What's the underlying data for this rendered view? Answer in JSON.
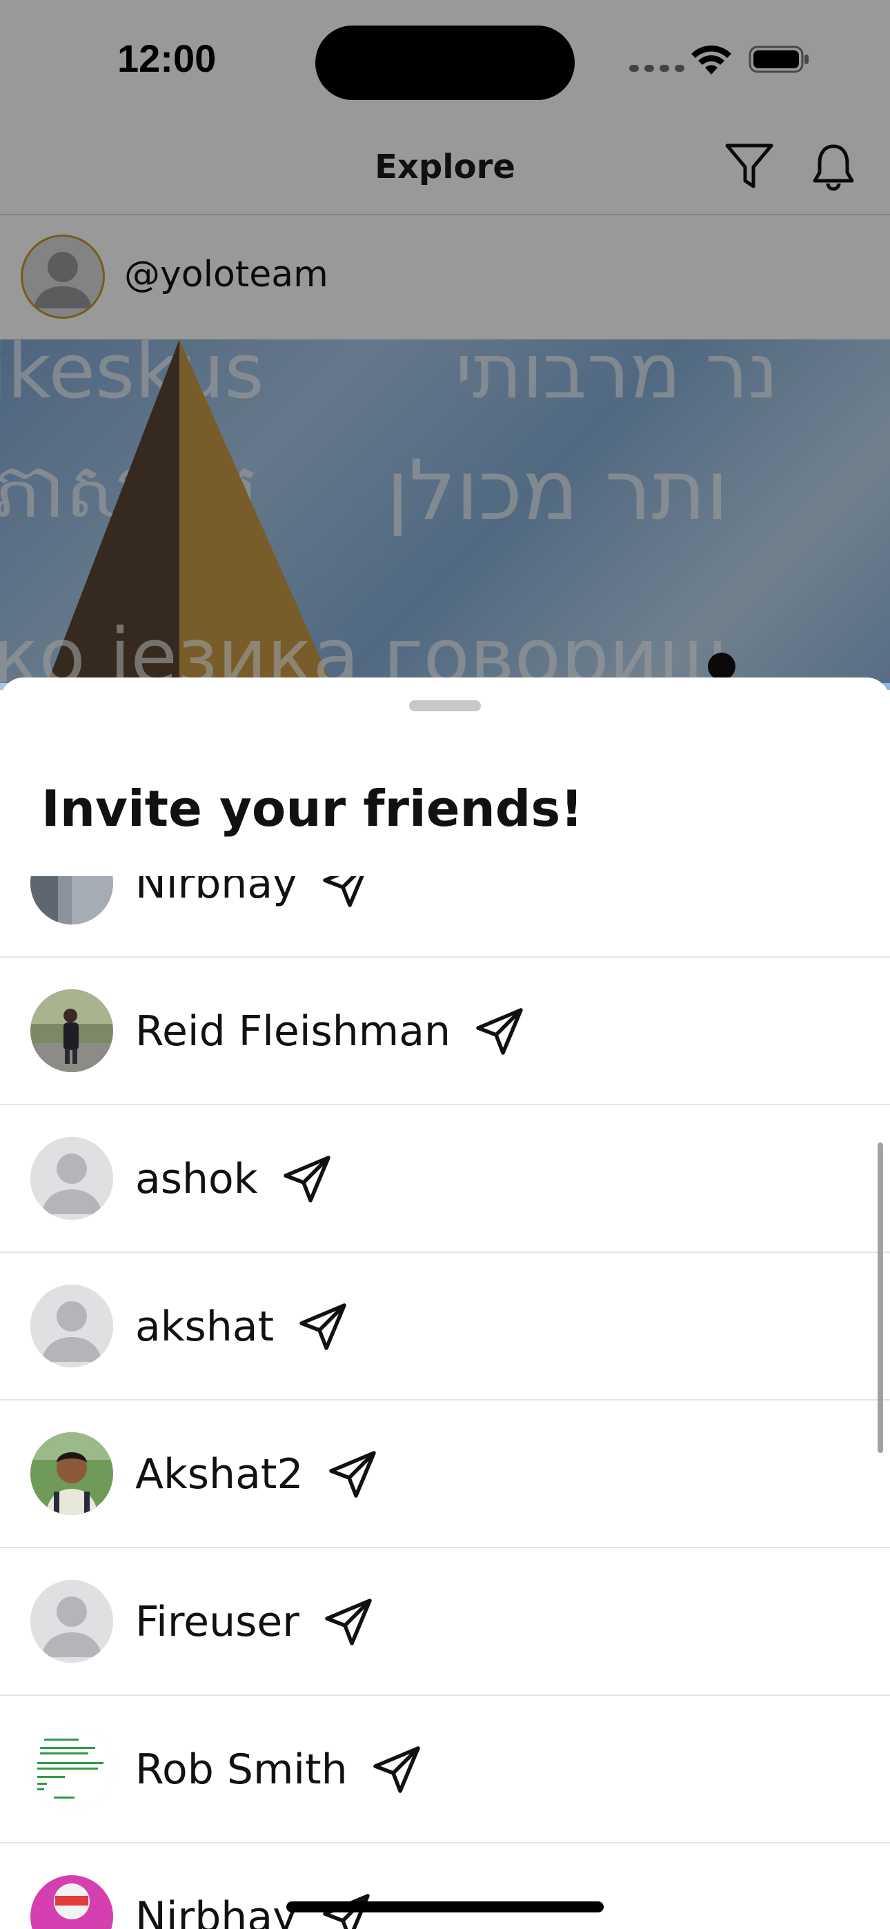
{
  "status_bar": {
    "time": "12:00"
  },
  "nav": {
    "title": "Explore"
  },
  "post": {
    "username": "@yoloteam",
    "image_text": {
      "line1_left": "ikeskus",
      "line1_right": "נר מרבותי",
      "line2_left": "ភាសាខ្មែរ",
      "line2_right": "ותר מכולן",
      "line3": "ко језика говориш"
    }
  },
  "sheet": {
    "title": "Invite your friends!",
    "friends": [
      {
        "name": "Nirbhay",
        "avatar": "photo-pillar"
      },
      {
        "name": "Reid Fleishman",
        "avatar": "photo-person-outdoors"
      },
      {
        "name": "ashok",
        "avatar": "placeholder"
      },
      {
        "name": "akshat",
        "avatar": "placeholder"
      },
      {
        "name": "Akshat2",
        "avatar": "photo-portrait"
      },
      {
        "name": "Fireuser",
        "avatar": "placeholder"
      },
      {
        "name": "Rob Smith",
        "avatar": "code-snippet"
      },
      {
        "name": "Nirbhay",
        "avatar": "photo-colorful"
      }
    ]
  },
  "colors": {
    "avatar_ring": "#c79a2a",
    "placeholder_bg": "#e0e0e3",
    "placeholder_fg": "#b4b4b9",
    "divider": "#e4e4e6"
  }
}
